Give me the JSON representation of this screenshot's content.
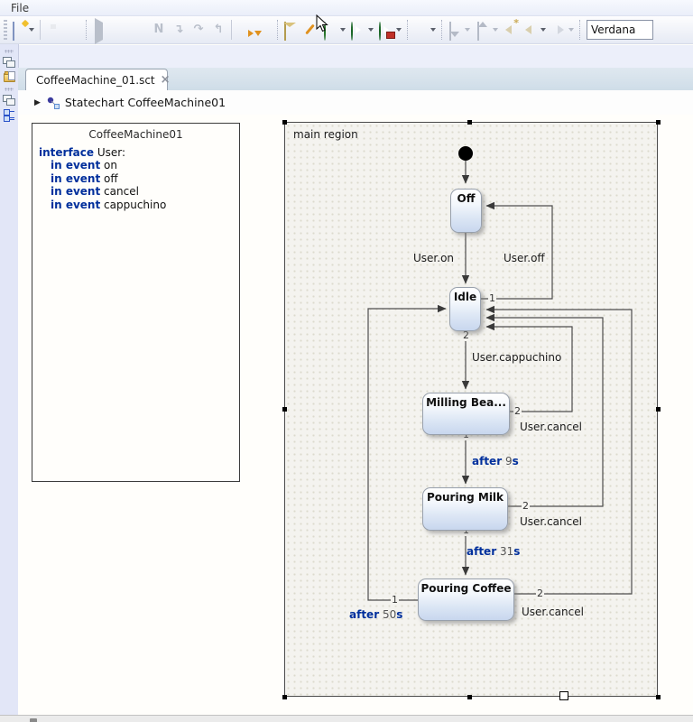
{
  "menubar": {
    "items": [
      "File"
    ]
  },
  "toolbar": {
    "icons": [
      "new-wizard",
      "save",
      "save-all",
      "resume",
      "pause",
      "terminate",
      "skip-breakpoints",
      "step-into",
      "step-over",
      "step-return",
      "run-last-tool",
      "generate-artifacts",
      "simulation",
      "generate-code",
      "debug",
      "run",
      "profile",
      "format-diagram",
      "import",
      "export",
      "last-edit-location",
      "back",
      "forward"
    ],
    "font_combo": {
      "value": "Verdana"
    }
  },
  "sidebar": {
    "icons": [
      "restore-view",
      "project-explorer",
      "restore-view",
      "outline-view"
    ]
  },
  "editor": {
    "tab": {
      "title": "CoffeeMachine_01.sct",
      "close": "×"
    },
    "breadcrumb": {
      "expand_glyph": "▶",
      "label": "Statechart CoffeeMachine01"
    }
  },
  "definition": {
    "title": "CoffeeMachine01",
    "lines": [
      {
        "keyword": "interface",
        "text": " User:"
      },
      {
        "keyword": "in event",
        "text": " on"
      },
      {
        "keyword": "in event",
        "text": " off"
      },
      {
        "keyword": "in event",
        "text": " cancel"
      },
      {
        "keyword": "in event",
        "text": " cappuchino"
      }
    ]
  },
  "diagram": {
    "region_label": "main region",
    "states": {
      "off": "Off",
      "idle": "Idle",
      "milling": "Milling Bea...",
      "pouring_milk": "Pouring Milk",
      "pouring_coffee": "Pouring Coffee"
    },
    "transitions": {
      "user_on": "User.on",
      "user_off": "User.off",
      "user_cappuchino": "User.cappuchino",
      "user_cancel": "User.cancel",
      "after_9": {
        "kw": "after",
        "val": " 9",
        "unit": "s"
      },
      "after_31": {
        "kw": "after",
        "val": " 31",
        "unit": "s"
      },
      "after_50": {
        "kw": "after",
        "val": " 50",
        "unit": "s"
      }
    },
    "priorities": {
      "p1": "1",
      "p2": "2"
    }
  },
  "colors": {
    "keyword_navy": "#002f9c",
    "number_gray": "#555555",
    "state_gradient_bottom": "#c8d7ee",
    "run_green": "#2f9e41",
    "region_fill": "#f4f3ef",
    "canvas_white": "#fffefb"
  }
}
